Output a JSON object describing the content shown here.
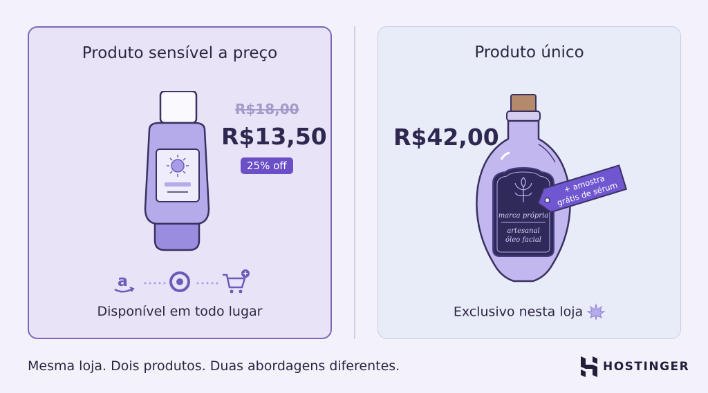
{
  "left_card": {
    "title": "Produto sensível a preço",
    "old_price": "R$18,00",
    "new_price": "R$13,50",
    "discount": "25% off",
    "caption": "Disponível em todo lugar",
    "store_icons": [
      "amazon-icon",
      "target-icon",
      "cart-plus-icon"
    ]
  },
  "right_card": {
    "title": "Produto único",
    "price": "R$42,00",
    "tag_line1": "+ amostra",
    "tag_line2": "grátis de sérum",
    "label_line1": "marca própria",
    "label_line2": "artesanal",
    "label_line3": "óleo facial",
    "caption": "Exclusivo nesta loja",
    "caption_icon": "leaf-icon"
  },
  "footer": {
    "tagline": "Mesma loja. Dois produtos. Duas abordagens diferentes.",
    "brand": "HOSTINGER"
  },
  "colors": {
    "accent": "#6a4fc7",
    "left_card_bg": "#e9e3f7",
    "right_card_bg": "#e8ebf8",
    "dark_text": "#2e2850"
  }
}
